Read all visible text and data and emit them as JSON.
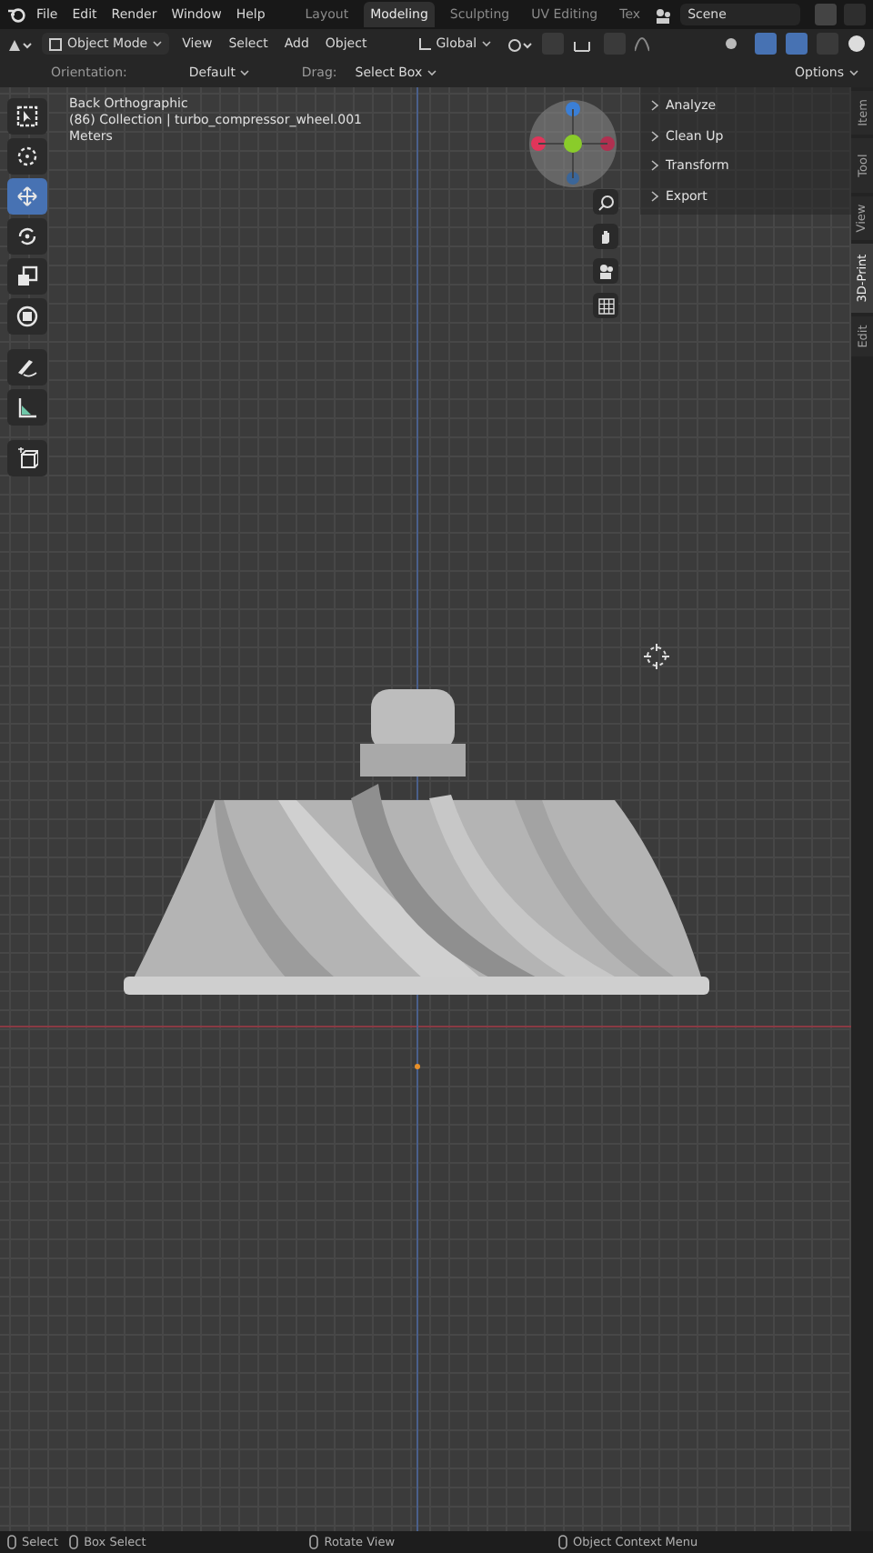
{
  "topbar": {
    "menus": [
      "File",
      "Edit",
      "Render",
      "Window",
      "Help"
    ],
    "workspaces": [
      {
        "label": "Layout",
        "selected": false
      },
      {
        "label": "Modeling",
        "selected": true
      },
      {
        "label": "Sculpting",
        "selected": false
      },
      {
        "label": "UV Editing",
        "selected": false
      },
      {
        "label": "Tex",
        "selected": false
      }
    ],
    "scene": "Scene"
  },
  "header": {
    "mode": "Object Mode",
    "menus": [
      "View",
      "Select",
      "Add",
      "Object"
    ],
    "orientation": "Global"
  },
  "tool_settings": {
    "orientation_label": "Orientation:",
    "orientation_value": "Default",
    "drag_label": "Drag:",
    "drag_value": "Select Box",
    "options": "Options"
  },
  "toolbar": {
    "tools": [
      {
        "kind": "select",
        "selected": false
      },
      {
        "kind": "cursor",
        "selected": false
      },
      {
        "kind": "move",
        "selected": true
      },
      {
        "kind": "rotate",
        "selected": false
      },
      {
        "kind": "scale",
        "selected": false
      },
      {
        "kind": "transform",
        "selected": false
      },
      {
        "kind": "annotate",
        "selected": false
      },
      {
        "kind": "measure",
        "selected": false
      },
      {
        "kind": "add-cube",
        "selected": false
      }
    ]
  },
  "viewport": {
    "view_name": "Back Orthographic",
    "collection": "(86) Collection | turbo_compressor_wheel.001",
    "units": "Meters"
  },
  "sidebar": {
    "panels": [
      {
        "label": "Analyze",
        "expanded": false
      },
      {
        "label": "Clean Up",
        "expanded": false
      },
      {
        "label": "Transform",
        "expanded": false
      },
      {
        "label": "Export",
        "expanded": false
      }
    ],
    "tabs": [
      {
        "label": "Item",
        "selected": false
      },
      {
        "label": "Tool",
        "selected": false
      },
      {
        "label": "View",
        "selected": false
      },
      {
        "label": "3D-Print",
        "selected": true
      },
      {
        "label": "Edit",
        "selected": false
      }
    ]
  },
  "status_bar": [
    {
      "label": "Select"
    },
    {
      "label": "Box Select"
    },
    {
      "label": "Rotate View"
    },
    {
      "label": "Object Context Menu"
    }
  ]
}
